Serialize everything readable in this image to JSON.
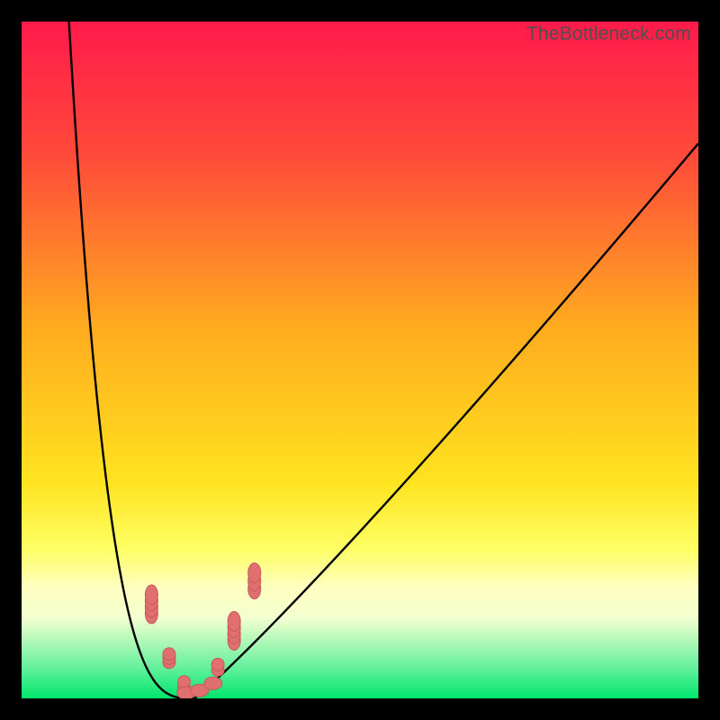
{
  "watermark": "TheBottleneck.com",
  "chart_data": {
    "type": "line",
    "title": "",
    "xlabel": "",
    "ylabel": "",
    "xlim": [
      0,
      100
    ],
    "ylim": [
      0,
      100
    ],
    "gradient_stops": [
      {
        "offset": 0.0,
        "color": "#ff1a4b"
      },
      {
        "offset": 0.2,
        "color": "#ff4b3a"
      },
      {
        "offset": 0.45,
        "color": "#ffab1f"
      },
      {
        "offset": 0.68,
        "color": "#ffe31f"
      },
      {
        "offset": 0.78,
        "color": "#ffff66"
      },
      {
        "offset": 0.835,
        "color": "#ffffc0"
      },
      {
        "offset": 0.882,
        "color": "#f3ffd0"
      },
      {
        "offset": 0.955,
        "color": "#63f09c"
      },
      {
        "offset": 1.0,
        "color": "#00e66b"
      }
    ],
    "series": [
      {
        "name": "bottleneck-curve",
        "vertex_x": 25.5,
        "left_start_x": 7.0,
        "right_end_x": 100.0,
        "right_end_y": 82.0,
        "left_steepness": 3.2,
        "right_steepness": 1.08
      }
    ],
    "markers": {
      "color": "#e07070",
      "stroke": "#c85a5a",
      "clusters": [
        {
          "cx": 19.2,
          "cy": 30.0,
          "count": 4,
          "spread": 3.5,
          "shape": "pill-vert"
        },
        {
          "cx": 21.8,
          "cy": 14.0,
          "count": 3,
          "spread": 3.0,
          "shape": "dot"
        },
        {
          "cx": 24.0,
          "cy": 5.0,
          "count": 2,
          "spread": 2.0,
          "shape": "dot"
        },
        {
          "cx": 26.3,
          "cy": 2.0,
          "count": 3,
          "spread": 2.0,
          "shape": "pill-horiz"
        },
        {
          "cx": 29.0,
          "cy": 7.0,
          "count": 2,
          "spread": 2.0,
          "shape": "dot"
        },
        {
          "cx": 31.4,
          "cy": 17.0,
          "count": 4,
          "spread": 3.5,
          "shape": "pill-vert"
        },
        {
          "cx": 34.4,
          "cy": 31.0,
          "count": 3,
          "spread": 3.0,
          "shape": "pill-vert"
        }
      ]
    }
  }
}
